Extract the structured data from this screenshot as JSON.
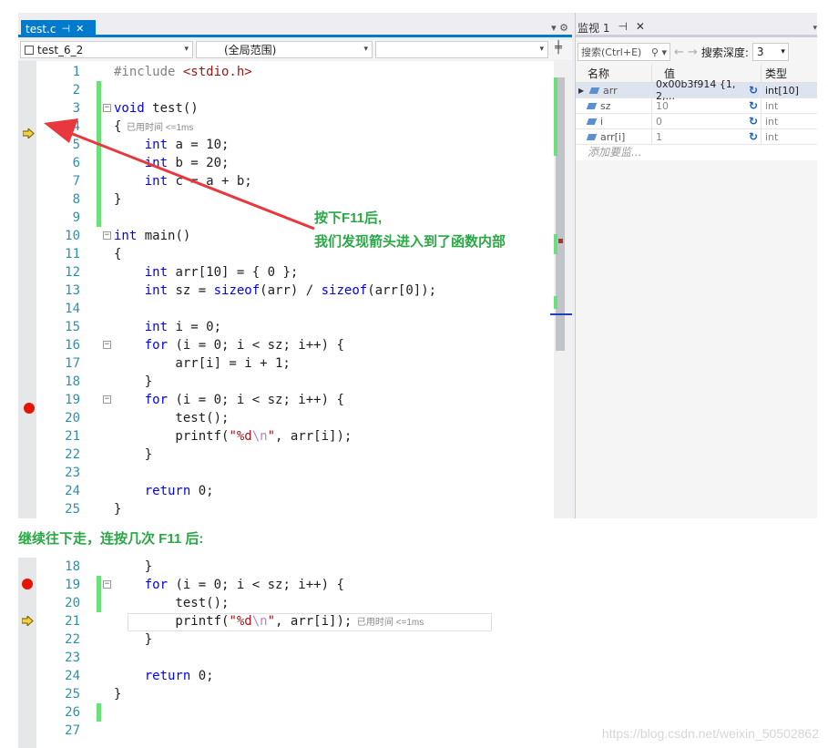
{
  "editor": {
    "tab_title": "test.c",
    "tab_pin": "⊣",
    "tab_close": "✕",
    "tab_tools": "▾ ⚙",
    "nav_scope": "test_6_2",
    "nav_global": "(全局范围)",
    "nav_member": "",
    "split_icon": "╪"
  },
  "code_top": [
    {
      "n": "1",
      "text": "#include <stdio.h>"
    },
    {
      "n": "2",
      "text": ""
    },
    {
      "n": "3",
      "text": "void test()"
    },
    {
      "n": "4",
      "text": "{"
    },
    {
      "n": "5",
      "text": "    int a = 10;"
    },
    {
      "n": "6",
      "text": "    int b = 20;"
    },
    {
      "n": "7",
      "text": "    int c = a + b;"
    },
    {
      "n": "8",
      "text": "}"
    },
    {
      "n": "9",
      "text": ""
    },
    {
      "n": "10",
      "text": "int main()"
    },
    {
      "n": "11",
      "text": "{"
    },
    {
      "n": "12",
      "text": "    int arr[10] = { 0 };"
    },
    {
      "n": "13",
      "text": "    int sz = sizeof(arr) / sizeof(arr[0]);"
    },
    {
      "n": "14",
      "text": ""
    },
    {
      "n": "15",
      "text": "    int i = 0;"
    },
    {
      "n": "16",
      "text": "    for (i = 0; i < sz; i++) {"
    },
    {
      "n": "17",
      "text": "        arr[i] = i + 1;"
    },
    {
      "n": "18",
      "text": "    }"
    },
    {
      "n": "19",
      "text": "    for (i = 0; i < sz; i++) {"
    },
    {
      "n": "20",
      "text": "        test();"
    },
    {
      "n": "21",
      "text": "        printf(\"%d\\n\", arr[i]);"
    },
    {
      "n": "22",
      "text": "    }"
    },
    {
      "n": "23",
      "text": ""
    },
    {
      "n": "24",
      "text": "    return 0;"
    },
    {
      "n": "25",
      "text": "}"
    }
  ],
  "perf_hint": "已用时间 <=1ms",
  "annotation": {
    "line1": "按下F11后,",
    "line2": "我们发现箭头进入到了函数内部"
  },
  "watch": {
    "tab_title": "监视 1",
    "search_placeholder": "搜索(Ctrl+E)",
    "search_icon": "⚲ ▾",
    "back": "←",
    "forward": "→",
    "depth_label": "搜索深度:",
    "depth_value": "3",
    "col_name": "名称",
    "col_value": "值",
    "col_type": "类型",
    "rows": [
      {
        "name": "arr",
        "value": "0x00b3f914 {1, 2,...",
        "type": "int[10]"
      },
      {
        "name": "sz",
        "value": "10",
        "type": "int"
      },
      {
        "name": "i",
        "value": "0",
        "type": "int"
      },
      {
        "name": "arr[i]",
        "value": "1",
        "type": "int"
      }
    ],
    "add_watch": "添加要监..."
  },
  "caption": "继续往下走，连按几次 F11 后:",
  "code_bottom": [
    {
      "n": "18",
      "text": "    }"
    },
    {
      "n": "19",
      "text": "    for (i = 0; i < sz; i++) {"
    },
    {
      "n": "20",
      "text": "        test();"
    },
    {
      "n": "21",
      "text": "        printf(\"%d\\n\", arr[i]);"
    },
    {
      "n": "22",
      "text": "    }"
    },
    {
      "n": "23",
      "text": ""
    },
    {
      "n": "24",
      "text": "    return 0;"
    },
    {
      "n": "25",
      "text": "}"
    },
    {
      "n": "26",
      "text": ""
    },
    {
      "n": "27",
      "text": ""
    }
  ],
  "watermark": "https://blog.csdn.net/weixin_50502862",
  "colors": {
    "accent": "#007acc",
    "annotation": "#2aa845",
    "arrow": "#e8373d",
    "breakpoint": "#e51400",
    "keyword": "#0000ff",
    "string": "#a31515"
  }
}
